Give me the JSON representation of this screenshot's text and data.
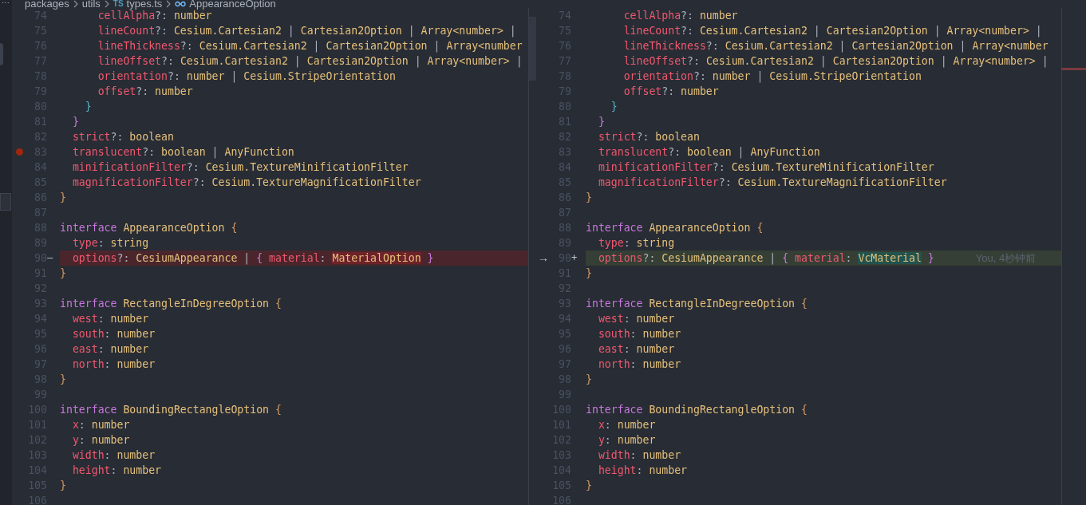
{
  "breadcrumb": {
    "more": "⋯",
    "items": [
      {
        "kind": "folder",
        "text": "packages"
      },
      {
        "kind": "folder",
        "text": "utils"
      },
      {
        "kind": "file",
        "badge": "TS",
        "text": "types.ts"
      },
      {
        "kind": "symbol",
        "text": "AppearanceOption"
      }
    ]
  },
  "left_pane": {
    "lines": [
      {
        "number": "74",
        "tokens": [
          {
            "kind": "key",
            "text": "      cellAlpha"
          },
          {
            "kind": "op",
            "text": "?: "
          },
          {
            "kind": "type",
            "text": "number"
          }
        ]
      },
      {
        "number": "75",
        "tokens": [
          {
            "kind": "key",
            "text": "      lineCount"
          },
          {
            "kind": "op",
            "text": "?: "
          },
          {
            "kind": "type",
            "text": "Cesium.Cartesian2"
          },
          {
            "kind": "p",
            "text": " | "
          },
          {
            "kind": "type",
            "text": "Cartesian2Option"
          },
          {
            "kind": "p",
            "text": " | "
          },
          {
            "kind": "type",
            "text": "Array<number>"
          },
          {
            "kind": "p",
            "text": " |"
          }
        ]
      },
      {
        "number": "76",
        "tokens": [
          {
            "kind": "key",
            "text": "      lineThickness"
          },
          {
            "kind": "op",
            "text": "?: "
          },
          {
            "kind": "type",
            "text": "Cesium.Cartesian2"
          },
          {
            "kind": "p",
            "text": " | "
          },
          {
            "kind": "type",
            "text": "Cartesian2Option"
          },
          {
            "kind": "p",
            "text": " | "
          },
          {
            "kind": "type",
            "text": "Array<number"
          }
        ]
      },
      {
        "number": "77",
        "tokens": [
          {
            "kind": "key",
            "text": "      lineOffset"
          },
          {
            "kind": "op",
            "text": "?: "
          },
          {
            "kind": "type",
            "text": "Cesium.Cartesian2"
          },
          {
            "kind": "p",
            "text": " | "
          },
          {
            "kind": "type",
            "text": "Cartesian2Option"
          },
          {
            "kind": "p",
            "text": " | "
          },
          {
            "kind": "type",
            "text": "Array<number>"
          },
          {
            "kind": "p",
            "text": " |"
          }
        ]
      },
      {
        "number": "78",
        "tokens": [
          {
            "kind": "key",
            "text": "      orientation"
          },
          {
            "kind": "op",
            "text": "?: "
          },
          {
            "kind": "type",
            "text": "number"
          },
          {
            "kind": "p",
            "text": " | "
          },
          {
            "kind": "type",
            "text": "Cesium.StripeOrientation"
          }
        ]
      },
      {
        "number": "79",
        "tokens": [
          {
            "kind": "key",
            "text": "      offset"
          },
          {
            "kind": "op",
            "text": "?: "
          },
          {
            "kind": "type",
            "text": "number"
          }
        ]
      },
      {
        "number": "80",
        "tokens": [
          {
            "kind": "b3",
            "text": "    }"
          }
        ]
      },
      {
        "number": "81",
        "tokens": [
          {
            "kind": "b2",
            "text": "  }"
          }
        ]
      },
      {
        "number": "82",
        "tokens": [
          {
            "kind": "key",
            "text": "  strict"
          },
          {
            "kind": "op",
            "text": "?: "
          },
          {
            "kind": "type",
            "text": "boolean"
          }
        ]
      },
      {
        "number": "83",
        "breakpoint": true,
        "tokens": [
          {
            "kind": "key",
            "text": "  translucent"
          },
          {
            "kind": "op",
            "text": "?: "
          },
          {
            "kind": "type",
            "text": "boolean"
          },
          {
            "kind": "p",
            "text": " | "
          },
          {
            "kind": "type",
            "text": "AnyFunction"
          }
        ]
      },
      {
        "number": "84",
        "tokens": [
          {
            "kind": "key",
            "text": "  minificationFilter"
          },
          {
            "kind": "op",
            "text": "?: "
          },
          {
            "kind": "type",
            "text": "Cesium.TextureMinificationFilter"
          }
        ]
      },
      {
        "number": "85",
        "tokens": [
          {
            "kind": "key",
            "text": "  magnificationFilter"
          },
          {
            "kind": "op",
            "text": "?: "
          },
          {
            "kind": "type",
            "text": "Cesium.TextureMagnificationFilter"
          }
        ]
      },
      {
        "number": "86",
        "tokens": [
          {
            "kind": "b1",
            "text": "}"
          }
        ]
      },
      {
        "number": "87"
      },
      {
        "number": "88",
        "tokens": [
          {
            "kind": "kw",
            "text": "interface "
          },
          {
            "kind": "type",
            "text": "AppearanceOption"
          },
          {
            "kind": "b1",
            "text": " {"
          }
        ]
      },
      {
        "number": "89",
        "tokens": [
          {
            "kind": "key",
            "text": "  type"
          },
          {
            "kind": "op",
            "text": ": "
          },
          {
            "kind": "type",
            "text": "string"
          }
        ]
      },
      {
        "number": "90",
        "deleted": true,
        "marker": "—",
        "tokens": [
          {
            "kind": "key",
            "text": "  options"
          },
          {
            "kind": "op",
            "text": "?: "
          },
          {
            "kind": "type",
            "text": "CesiumAppearance"
          },
          {
            "kind": "p",
            "text": " | "
          },
          {
            "kind": "b2",
            "text": "{ "
          },
          {
            "kind": "key",
            "text": "material"
          },
          {
            "kind": "op",
            "text": ": "
          },
          {
            "kind": "type",
            "text": "MaterialOption",
            "changed": true
          },
          {
            "kind": "b2",
            "text": " }"
          }
        ]
      },
      {
        "number": "91",
        "tokens": [
          {
            "kind": "b1",
            "text": "}"
          }
        ]
      },
      {
        "number": "92"
      },
      {
        "number": "93",
        "tokens": [
          {
            "kind": "kw",
            "text": "interface "
          },
          {
            "kind": "type",
            "text": "RectangleInDegreeOption"
          },
          {
            "kind": "b1",
            "text": " {"
          }
        ]
      },
      {
        "number": "94",
        "tokens": [
          {
            "kind": "key",
            "text": "  west"
          },
          {
            "kind": "op",
            "text": ": "
          },
          {
            "kind": "type",
            "text": "number"
          }
        ]
      },
      {
        "number": "95",
        "tokens": [
          {
            "kind": "key",
            "text": "  south"
          },
          {
            "kind": "op",
            "text": ": "
          },
          {
            "kind": "type",
            "text": "number"
          }
        ]
      },
      {
        "number": "96",
        "tokens": [
          {
            "kind": "key",
            "text": "  east"
          },
          {
            "kind": "op",
            "text": ": "
          },
          {
            "kind": "type",
            "text": "number"
          }
        ]
      },
      {
        "number": "97",
        "tokens": [
          {
            "kind": "key",
            "text": "  north"
          },
          {
            "kind": "op",
            "text": ": "
          },
          {
            "kind": "type",
            "text": "number"
          }
        ]
      },
      {
        "number": "98",
        "tokens": [
          {
            "kind": "b1",
            "text": "}"
          }
        ]
      },
      {
        "number": "99"
      },
      {
        "number": "100",
        "tokens": [
          {
            "kind": "kw",
            "text": "interface "
          },
          {
            "kind": "type",
            "text": "BoundingRectangleOption"
          },
          {
            "kind": "b1",
            "text": " {"
          }
        ]
      },
      {
        "number": "101",
        "tokens": [
          {
            "kind": "key",
            "text": "  x"
          },
          {
            "kind": "op",
            "text": ": "
          },
          {
            "kind": "type",
            "text": "number"
          }
        ]
      },
      {
        "number": "102",
        "tokens": [
          {
            "kind": "key",
            "text": "  y"
          },
          {
            "kind": "op",
            "text": ": "
          },
          {
            "kind": "type",
            "text": "number"
          }
        ]
      },
      {
        "number": "103",
        "tokens": [
          {
            "kind": "key",
            "text": "  width"
          },
          {
            "kind": "op",
            "text": ": "
          },
          {
            "kind": "type",
            "text": "number"
          }
        ]
      },
      {
        "number": "104",
        "tokens": [
          {
            "kind": "key",
            "text": "  height"
          },
          {
            "kind": "op",
            "text": ": "
          },
          {
            "kind": "type",
            "text": "number"
          }
        ]
      },
      {
        "number": "105",
        "tokens": [
          {
            "kind": "b1",
            "text": "}"
          }
        ]
      },
      {
        "number": "106"
      }
    ]
  },
  "right_pane": {
    "lines": [
      {
        "number": "74",
        "tokens": [
          {
            "kind": "key",
            "text": "      cellAlpha"
          },
          {
            "kind": "op",
            "text": "?: "
          },
          {
            "kind": "type",
            "text": "number"
          }
        ]
      },
      {
        "number": "75",
        "tokens": [
          {
            "kind": "key",
            "text": "      lineCount"
          },
          {
            "kind": "op",
            "text": "?: "
          },
          {
            "kind": "type",
            "text": "Cesium.Cartesian2"
          },
          {
            "kind": "p",
            "text": " | "
          },
          {
            "kind": "type",
            "text": "Cartesian2Option"
          },
          {
            "kind": "p",
            "text": " | "
          },
          {
            "kind": "type",
            "text": "Array<number>"
          },
          {
            "kind": "p",
            "text": " |"
          }
        ]
      },
      {
        "number": "76",
        "tokens": [
          {
            "kind": "key",
            "text": "      lineThickness"
          },
          {
            "kind": "op",
            "text": "?: "
          },
          {
            "kind": "type",
            "text": "Cesium.Cartesian2"
          },
          {
            "kind": "p",
            "text": " | "
          },
          {
            "kind": "type",
            "text": "Cartesian2Option"
          },
          {
            "kind": "p",
            "text": " | "
          },
          {
            "kind": "type",
            "text": "Array<number"
          }
        ]
      },
      {
        "number": "77",
        "tokens": [
          {
            "kind": "key",
            "text": "      lineOffset"
          },
          {
            "kind": "op",
            "text": "?: "
          },
          {
            "kind": "type",
            "text": "Cesium.Cartesian2"
          },
          {
            "kind": "p",
            "text": " | "
          },
          {
            "kind": "type",
            "text": "Cartesian2Option"
          },
          {
            "kind": "p",
            "text": " | "
          },
          {
            "kind": "type",
            "text": "Array<number>"
          },
          {
            "kind": "p",
            "text": " |"
          }
        ]
      },
      {
        "number": "78",
        "tokens": [
          {
            "kind": "key",
            "text": "      orientation"
          },
          {
            "kind": "op",
            "text": "?: "
          },
          {
            "kind": "type",
            "text": "number"
          },
          {
            "kind": "p",
            "text": " | "
          },
          {
            "kind": "type",
            "text": "Cesium.StripeOrientation"
          }
        ]
      },
      {
        "number": "79",
        "tokens": [
          {
            "kind": "key",
            "text": "      offset"
          },
          {
            "kind": "op",
            "text": "?: "
          },
          {
            "kind": "type",
            "text": "number"
          }
        ]
      },
      {
        "number": "80",
        "tokens": [
          {
            "kind": "b3",
            "text": "    }"
          }
        ]
      },
      {
        "number": "81",
        "tokens": [
          {
            "kind": "b2",
            "text": "  }"
          }
        ]
      },
      {
        "number": "82",
        "tokens": [
          {
            "kind": "key",
            "text": "  strict"
          },
          {
            "kind": "op",
            "text": "?: "
          },
          {
            "kind": "type",
            "text": "boolean"
          }
        ]
      },
      {
        "number": "83",
        "tokens": [
          {
            "kind": "key",
            "text": "  translucent"
          },
          {
            "kind": "op",
            "text": "?: "
          },
          {
            "kind": "type",
            "text": "boolean"
          },
          {
            "kind": "p",
            "text": " | "
          },
          {
            "kind": "type",
            "text": "AnyFunction"
          }
        ]
      },
      {
        "number": "84",
        "tokens": [
          {
            "kind": "key",
            "text": "  minificationFilter"
          },
          {
            "kind": "op",
            "text": "?: "
          },
          {
            "kind": "type",
            "text": "Cesium.TextureMinificationFilter"
          }
        ]
      },
      {
        "number": "85",
        "tokens": [
          {
            "kind": "key",
            "text": "  magnificationFilter"
          },
          {
            "kind": "op",
            "text": "?: "
          },
          {
            "kind": "type",
            "text": "Cesium.TextureMagnificationFilter"
          }
        ]
      },
      {
        "number": "86",
        "tokens": [
          {
            "kind": "b1",
            "text": "}"
          }
        ]
      },
      {
        "number": "87"
      },
      {
        "number": "88",
        "tokens": [
          {
            "kind": "kw",
            "text": "interface "
          },
          {
            "kind": "type",
            "text": "AppearanceOption"
          },
          {
            "kind": "b1",
            "text": " {"
          }
        ]
      },
      {
        "number": "89",
        "tokens": [
          {
            "kind": "key",
            "text": "  type"
          },
          {
            "kind": "op",
            "text": ": "
          },
          {
            "kind": "type",
            "text": "string"
          }
        ]
      },
      {
        "number": "90",
        "inserted": true,
        "marker": "+",
        "revert_arrow": "→",
        "blame": "You, 4秒钟前",
        "tokens": [
          {
            "kind": "key",
            "text": "  options"
          },
          {
            "kind": "op",
            "text": "?: "
          },
          {
            "kind": "type",
            "text": "CesiumAppearance"
          },
          {
            "kind": "p",
            "text": " | "
          },
          {
            "kind": "b2",
            "text": "{ "
          },
          {
            "kind": "key",
            "text": "material"
          },
          {
            "kind": "op",
            "text": ": "
          },
          {
            "kind": "type",
            "text": "VcMaterial",
            "changed": true
          },
          {
            "kind": "b2",
            "text": " }"
          }
        ]
      },
      {
        "number": "91",
        "tokens": [
          {
            "kind": "b1",
            "text": "}"
          }
        ]
      },
      {
        "number": "92"
      },
      {
        "number": "93",
        "tokens": [
          {
            "kind": "kw",
            "text": "interface "
          },
          {
            "kind": "type",
            "text": "RectangleInDegreeOption"
          },
          {
            "kind": "b1",
            "text": " {"
          }
        ]
      },
      {
        "number": "94",
        "tokens": [
          {
            "kind": "key",
            "text": "  west"
          },
          {
            "kind": "op",
            "text": ": "
          },
          {
            "kind": "type",
            "text": "number"
          }
        ]
      },
      {
        "number": "95",
        "tokens": [
          {
            "kind": "key",
            "text": "  south"
          },
          {
            "kind": "op",
            "text": ": "
          },
          {
            "kind": "type",
            "text": "number"
          }
        ]
      },
      {
        "number": "96",
        "tokens": [
          {
            "kind": "key",
            "text": "  east"
          },
          {
            "kind": "op",
            "text": ": "
          },
          {
            "kind": "type",
            "text": "number"
          }
        ]
      },
      {
        "number": "97",
        "tokens": [
          {
            "kind": "key",
            "text": "  north"
          },
          {
            "kind": "op",
            "text": ": "
          },
          {
            "kind": "type",
            "text": "number"
          }
        ]
      },
      {
        "number": "98",
        "tokens": [
          {
            "kind": "b1",
            "text": "}"
          }
        ]
      },
      {
        "number": "99"
      },
      {
        "number": "100",
        "tokens": [
          {
            "kind": "kw",
            "text": "interface "
          },
          {
            "kind": "type",
            "text": "BoundingRectangleOption"
          },
          {
            "kind": "b1",
            "text": " {"
          }
        ]
      },
      {
        "number": "101",
        "tokens": [
          {
            "kind": "key",
            "text": "  x"
          },
          {
            "kind": "op",
            "text": ": "
          },
          {
            "kind": "type",
            "text": "number"
          }
        ]
      },
      {
        "number": "102",
        "tokens": [
          {
            "kind": "key",
            "text": "  y"
          },
          {
            "kind": "op",
            "text": ": "
          },
          {
            "kind": "type",
            "text": "number"
          }
        ]
      },
      {
        "number": "103",
        "tokens": [
          {
            "kind": "key",
            "text": "  width"
          },
          {
            "kind": "op",
            "text": ": "
          },
          {
            "kind": "type",
            "text": "number"
          }
        ]
      },
      {
        "number": "104",
        "tokens": [
          {
            "kind": "key",
            "text": "  height"
          },
          {
            "kind": "op",
            "text": ": "
          },
          {
            "kind": "type",
            "text": "number"
          }
        ]
      },
      {
        "number": "105",
        "tokens": [
          {
            "kind": "b1",
            "text": "}"
          }
        ]
      },
      {
        "number": "106"
      }
    ]
  }
}
